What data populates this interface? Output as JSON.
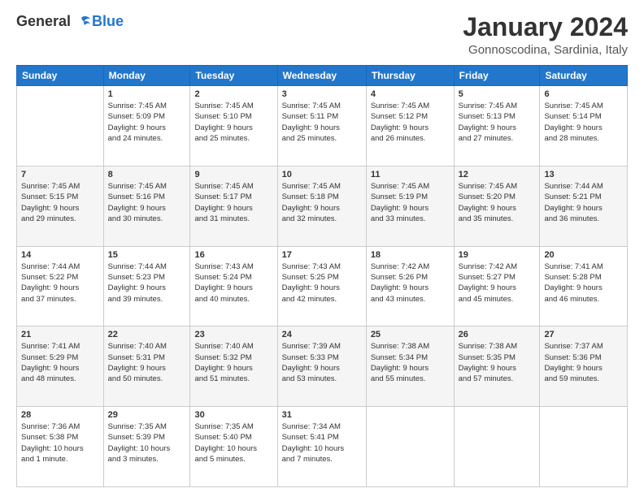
{
  "logo": {
    "general": "General",
    "blue": "Blue"
  },
  "title": "January 2024",
  "location": "Gonnoscodina, Sardinia, Italy",
  "headers": [
    "Sunday",
    "Monday",
    "Tuesday",
    "Wednesday",
    "Thursday",
    "Friday",
    "Saturday"
  ],
  "weeks": [
    [
      {
        "day": "",
        "info": ""
      },
      {
        "day": "1",
        "info": "Sunrise: 7:45 AM\nSunset: 5:09 PM\nDaylight: 9 hours\nand 24 minutes."
      },
      {
        "day": "2",
        "info": "Sunrise: 7:45 AM\nSunset: 5:10 PM\nDaylight: 9 hours\nand 25 minutes."
      },
      {
        "day": "3",
        "info": "Sunrise: 7:45 AM\nSunset: 5:11 PM\nDaylight: 9 hours\nand 25 minutes."
      },
      {
        "day": "4",
        "info": "Sunrise: 7:45 AM\nSunset: 5:12 PM\nDaylight: 9 hours\nand 26 minutes."
      },
      {
        "day": "5",
        "info": "Sunrise: 7:45 AM\nSunset: 5:13 PM\nDaylight: 9 hours\nand 27 minutes."
      },
      {
        "day": "6",
        "info": "Sunrise: 7:45 AM\nSunset: 5:14 PM\nDaylight: 9 hours\nand 28 minutes."
      }
    ],
    [
      {
        "day": "7",
        "info": "Sunrise: 7:45 AM\nSunset: 5:15 PM\nDaylight: 9 hours\nand 29 minutes."
      },
      {
        "day": "8",
        "info": "Sunrise: 7:45 AM\nSunset: 5:16 PM\nDaylight: 9 hours\nand 30 minutes."
      },
      {
        "day": "9",
        "info": "Sunrise: 7:45 AM\nSunset: 5:17 PM\nDaylight: 9 hours\nand 31 minutes."
      },
      {
        "day": "10",
        "info": "Sunrise: 7:45 AM\nSunset: 5:18 PM\nDaylight: 9 hours\nand 32 minutes."
      },
      {
        "day": "11",
        "info": "Sunrise: 7:45 AM\nSunset: 5:19 PM\nDaylight: 9 hours\nand 33 minutes."
      },
      {
        "day": "12",
        "info": "Sunrise: 7:45 AM\nSunset: 5:20 PM\nDaylight: 9 hours\nand 35 minutes."
      },
      {
        "day": "13",
        "info": "Sunrise: 7:44 AM\nSunset: 5:21 PM\nDaylight: 9 hours\nand 36 minutes."
      }
    ],
    [
      {
        "day": "14",
        "info": "Sunrise: 7:44 AM\nSunset: 5:22 PM\nDaylight: 9 hours\nand 37 minutes."
      },
      {
        "day": "15",
        "info": "Sunrise: 7:44 AM\nSunset: 5:23 PM\nDaylight: 9 hours\nand 39 minutes."
      },
      {
        "day": "16",
        "info": "Sunrise: 7:43 AM\nSunset: 5:24 PM\nDaylight: 9 hours\nand 40 minutes."
      },
      {
        "day": "17",
        "info": "Sunrise: 7:43 AM\nSunset: 5:25 PM\nDaylight: 9 hours\nand 42 minutes."
      },
      {
        "day": "18",
        "info": "Sunrise: 7:42 AM\nSunset: 5:26 PM\nDaylight: 9 hours\nand 43 minutes."
      },
      {
        "day": "19",
        "info": "Sunrise: 7:42 AM\nSunset: 5:27 PM\nDaylight: 9 hours\nand 45 minutes."
      },
      {
        "day": "20",
        "info": "Sunrise: 7:41 AM\nSunset: 5:28 PM\nDaylight: 9 hours\nand 46 minutes."
      }
    ],
    [
      {
        "day": "21",
        "info": "Sunrise: 7:41 AM\nSunset: 5:29 PM\nDaylight: 9 hours\nand 48 minutes."
      },
      {
        "day": "22",
        "info": "Sunrise: 7:40 AM\nSunset: 5:31 PM\nDaylight: 9 hours\nand 50 minutes."
      },
      {
        "day": "23",
        "info": "Sunrise: 7:40 AM\nSunset: 5:32 PM\nDaylight: 9 hours\nand 51 minutes."
      },
      {
        "day": "24",
        "info": "Sunrise: 7:39 AM\nSunset: 5:33 PM\nDaylight: 9 hours\nand 53 minutes."
      },
      {
        "day": "25",
        "info": "Sunrise: 7:38 AM\nSunset: 5:34 PM\nDaylight: 9 hours\nand 55 minutes."
      },
      {
        "day": "26",
        "info": "Sunrise: 7:38 AM\nSunset: 5:35 PM\nDaylight: 9 hours\nand 57 minutes."
      },
      {
        "day": "27",
        "info": "Sunrise: 7:37 AM\nSunset: 5:36 PM\nDaylight: 9 hours\nand 59 minutes."
      }
    ],
    [
      {
        "day": "28",
        "info": "Sunrise: 7:36 AM\nSunset: 5:38 PM\nDaylight: 10 hours\nand 1 minute."
      },
      {
        "day": "29",
        "info": "Sunrise: 7:35 AM\nSunset: 5:39 PM\nDaylight: 10 hours\nand 3 minutes."
      },
      {
        "day": "30",
        "info": "Sunrise: 7:35 AM\nSunset: 5:40 PM\nDaylight: 10 hours\nand 5 minutes."
      },
      {
        "day": "31",
        "info": "Sunrise: 7:34 AM\nSunset: 5:41 PM\nDaylight: 10 hours\nand 7 minutes."
      },
      {
        "day": "",
        "info": ""
      },
      {
        "day": "",
        "info": ""
      },
      {
        "day": "",
        "info": ""
      }
    ]
  ]
}
